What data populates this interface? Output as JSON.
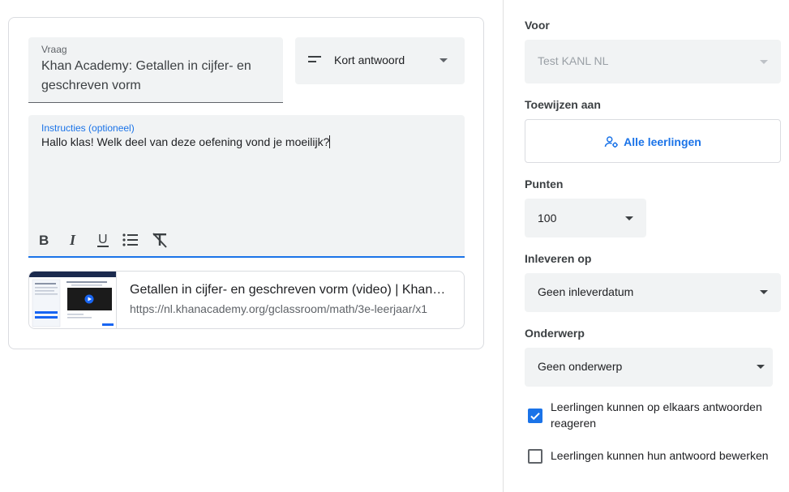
{
  "question": {
    "label": "Vraag",
    "value": "Khan Academy: Getallen in cijfer- en geschreven vorm"
  },
  "question_type": {
    "icon": "short-answer-icon",
    "label": "Kort antwoord"
  },
  "instructions": {
    "label": "Instructies (optioneel)",
    "value": "Hallo klas! Welk deel van deze oefening vond je moeilijk?"
  },
  "formatting": {
    "bold": "B",
    "italic": "I",
    "underline": "U"
  },
  "attachment": {
    "title": "Getallen in cijfer- en geschreven vorm (video) | Khan Academy",
    "url": "https://nl.khanacademy.org/gclassroom/math/3e-leerjaar/x1"
  },
  "sidebar": {
    "for_label": "Voor",
    "for_value": "Test KANL NL",
    "assign_label": "Toewijzen aan",
    "assign_value": "Alle leerlingen",
    "points_label": "Punten",
    "points_value": "100",
    "due_label": "Inleveren op",
    "due_value": "Geen inleverdatum",
    "topic_label": "Onderwerp",
    "topic_value": "Geen onderwerp",
    "option_reply": {
      "label": "Leerlingen kunnen op elkaars antwoorden reageren",
      "checked": true
    },
    "option_edit": {
      "label": "Leerlingen kunnen hun antwoord bewerken",
      "checked": false
    }
  },
  "colors": {
    "accent": "#1a73e8",
    "field_bg": "#f1f3f4",
    "border": "#dadce0"
  }
}
